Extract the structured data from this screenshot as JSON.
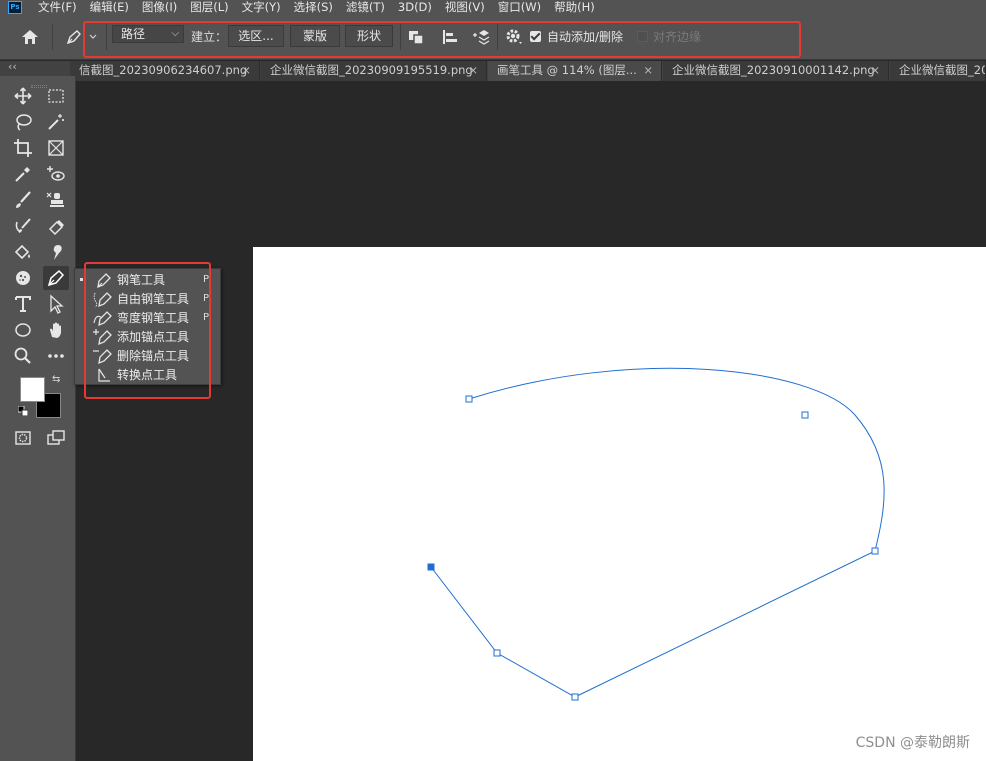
{
  "app": {
    "logo_text": "Ps"
  },
  "menu": [
    {
      "label": "文件(F)"
    },
    {
      "label": "编辑(E)"
    },
    {
      "label": "图像(I)"
    },
    {
      "label": "图层(L)"
    },
    {
      "label": "文字(Y)"
    },
    {
      "label": "选择(S)"
    },
    {
      "label": "滤镜(T)"
    },
    {
      "label": "3D(D)"
    },
    {
      "label": "视图(V)"
    },
    {
      "label": "窗口(W)"
    },
    {
      "label": "帮助(H)"
    }
  ],
  "options": {
    "mode_value": "路径",
    "make_label": "建立：",
    "selection_btn": "选区...",
    "mask_btn": "蒙版",
    "shape_btn": "形状",
    "auto_add_label": "自动添加/删除",
    "auto_add_checked": true,
    "align_edges_label": "对齐边缘",
    "align_edges_checked": false
  },
  "tabs": [
    {
      "label": "信截图_20230906234607.png",
      "close": "×"
    },
    {
      "label": "企业微信截图_20230909195519.png",
      "close": "×"
    },
    {
      "label": "画笔工具 @ 114% (图层...",
      "close": "×"
    },
    {
      "label": "企业微信截图_20230910001142.png",
      "close": "×"
    },
    {
      "label": "企业微信截图_20",
      "close": ""
    }
  ],
  "panel_collapse": "‹‹",
  "flyout": [
    {
      "label": "钢笔工具",
      "shortcut": "P",
      "icon": "pen-icon",
      "active": true
    },
    {
      "label": "自由钢笔工具",
      "shortcut": "P",
      "icon": "freeform-pen-icon",
      "active": false
    },
    {
      "label": "弯度钢笔工具",
      "shortcut": "P",
      "icon": "curvature-pen-icon",
      "active": false
    },
    {
      "label": "添加锚点工具",
      "shortcut": "",
      "icon": "add-anchor-icon",
      "active": false
    },
    {
      "label": "删除锚点工具",
      "shortcut": "",
      "icon": "delete-anchor-icon",
      "active": false
    },
    {
      "label": "转换点工具",
      "shortcut": "",
      "icon": "convert-point-icon",
      "active": false
    }
  ],
  "colors": {
    "foreground": "#ffffff",
    "background": "#000000",
    "path_stroke": "#1f6fd1",
    "highlight": "#e53935"
  },
  "watermark": "CSDN @泰勒朗斯"
}
